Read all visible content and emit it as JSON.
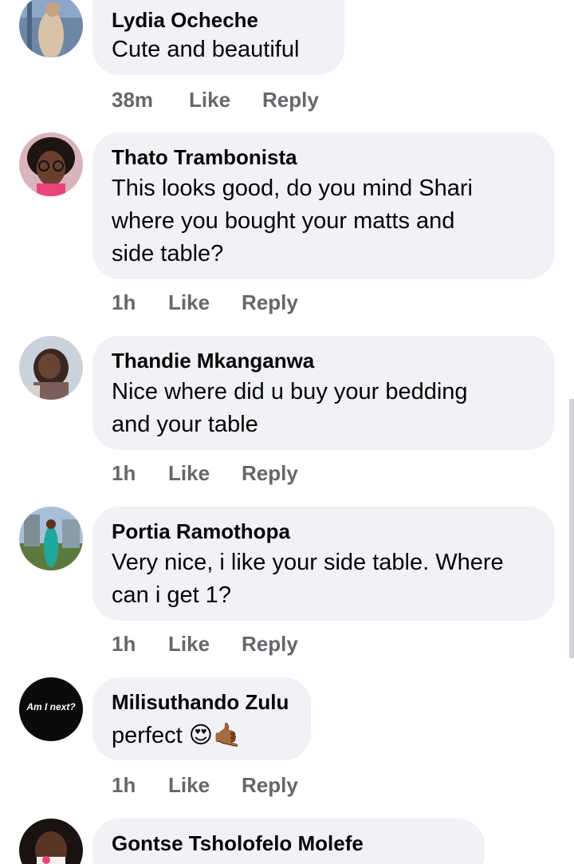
{
  "comments": [
    {
      "author": "Lydia Ocheche",
      "lines": [
        "Cute and beautiful"
      ],
      "time": "38m",
      "like": "Like",
      "reply": "Reply"
    },
    {
      "author": "Thato Trambonista",
      "lines": [
        "This looks good, do you mind Shari",
        "where you bought your matts and",
        "side table?"
      ],
      "time": "1h",
      "like": "Like",
      "reply": "Reply"
    },
    {
      "author": "Thandie Mkanganwa",
      "lines": [
        "Nice where did u buy your bedding",
        "and your table"
      ],
      "time": "1h",
      "like": "Like",
      "reply": "Reply"
    },
    {
      "author": "Portia Ramothopa",
      "lines": [
        "Very nice, i like your side table. Where",
        "can i get 1?"
      ],
      "time": "1h",
      "like": "Like",
      "reply": "Reply"
    },
    {
      "author": "Milisuthando Zulu",
      "lines": [
        "perfect 😍🤙🏾"
      ],
      "time": "1h",
      "like": "Like",
      "reply": "Reply",
      "avatar_text": "Am I next?"
    },
    {
      "author": "Gontse Tsholofelo Molefe",
      "lines": [],
      "time": "",
      "like": "",
      "reply": ""
    }
  ],
  "colors": {
    "bubble": "#f0f2f5",
    "meta": "#65676b",
    "text": "#050505"
  }
}
